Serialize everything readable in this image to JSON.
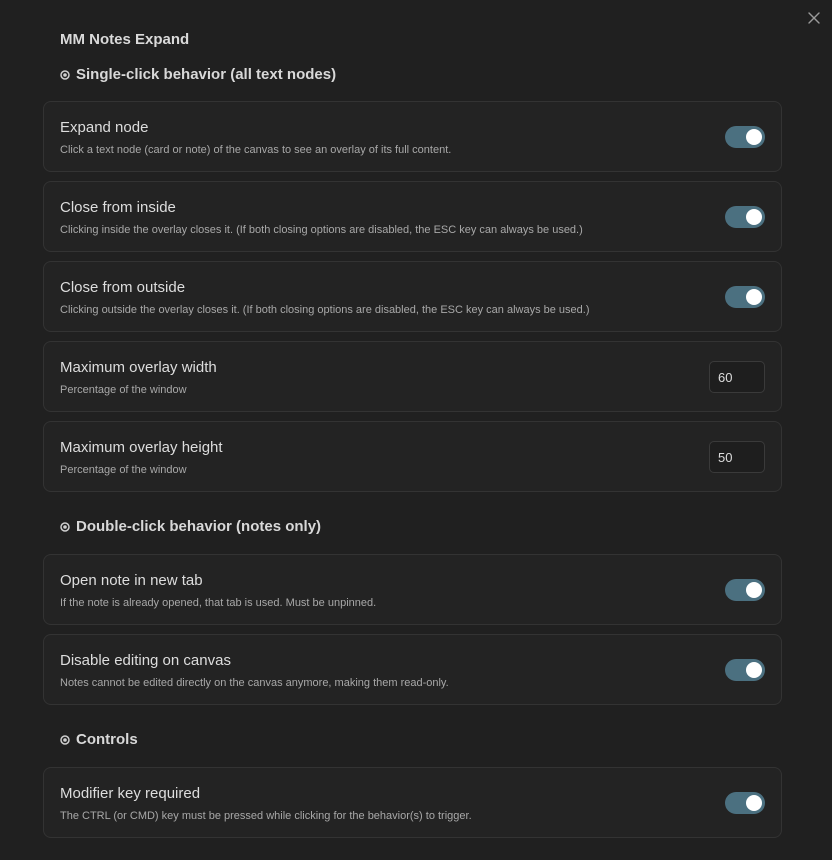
{
  "plugin_title": "MM Notes Expand",
  "sections": [
    {
      "heading": "Single-click behavior (all text nodes)",
      "settings": [
        {
          "name": "Expand node",
          "description": "Click a text node (card or note) of the canvas to see an overlay of its full content.",
          "control": "toggle",
          "enabled": true
        },
        {
          "name": "Close from inside",
          "description": "Clicking inside the overlay closes it. (If both closing options are disabled, the ESC key can always be used.)",
          "control": "toggle",
          "enabled": true
        },
        {
          "name": "Close from outside",
          "description": "Clicking outside the overlay closes it. (If both closing options are disabled, the ESC key can always be used.)",
          "control": "toggle",
          "enabled": true
        },
        {
          "name": "Maximum overlay width",
          "description": "Percentage of the window",
          "control": "number",
          "value": "60"
        },
        {
          "name": "Maximum overlay height",
          "description": "Percentage of the window",
          "control": "number",
          "value": "50"
        }
      ]
    },
    {
      "heading": "Double-click behavior (notes only)",
      "settings": [
        {
          "name": "Open note in new tab",
          "description": "If the note is already opened, that tab is used. Must be unpinned.",
          "control": "toggle",
          "enabled": true
        },
        {
          "name": "Disable editing on canvas",
          "description": "Notes cannot be edited directly on the canvas anymore, making them read-only.",
          "control": "toggle",
          "enabled": true
        }
      ]
    },
    {
      "heading": "Controls",
      "settings": [
        {
          "name": "Modifier key required",
          "description": "The CTRL (or CMD) key must be pressed while clicking for the behavior(s) to trigger.",
          "control": "toggle",
          "enabled": true
        }
      ]
    }
  ],
  "icons": {
    "close": "close-icon",
    "section_heading": "circle-dot-icon"
  },
  "colors": {
    "background": "#202020",
    "toggle_on": "#4b7080",
    "card_border": "#333333"
  }
}
